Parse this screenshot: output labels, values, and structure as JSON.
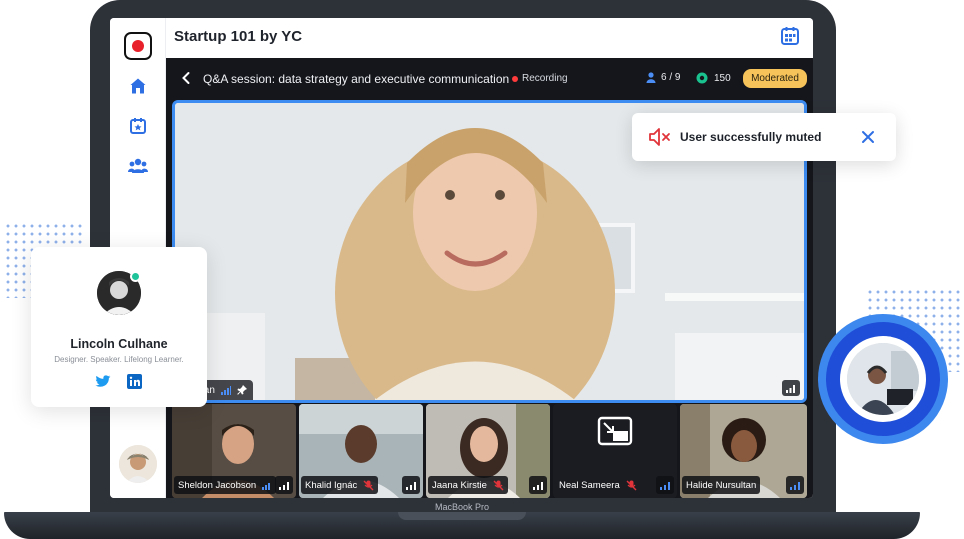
{
  "app": {
    "title": "Startup 101 by YC"
  },
  "sidebar": {
    "items": [
      {
        "name": "record",
        "icon": "record-icon"
      },
      {
        "name": "home",
        "icon": "home-icon"
      },
      {
        "name": "events",
        "icon": "calendar-star-icon"
      },
      {
        "name": "community",
        "icon": "users-icon"
      }
    ]
  },
  "session": {
    "title": "Q&A session: data strategy and executive communication",
    "recording_label": "Recording",
    "participants": "6 / 9",
    "viewers": "150",
    "badge": "Moderated",
    "active_speaker": "herman"
  },
  "tiles": [
    {
      "name": "Sheldon Jacobson",
      "muted": false
    },
    {
      "name": "Khalid Ignác",
      "muted": true
    },
    {
      "name": "Jaana Kirstie",
      "muted": true
    },
    {
      "name": "Neal Sameera",
      "muted": true
    },
    {
      "name": "Halide Nursultan",
      "muted": false
    }
  ],
  "toast": {
    "message": "User successfully muted"
  },
  "profile": {
    "name": "Lincoln Culhane",
    "bio": "Designer. Speaker. Lifelong Learner."
  },
  "device_label": "MacBook Pro",
  "colors": {
    "accent": "#3d8cf2",
    "recording": "#ff3b3b",
    "badge": "#f6c35b",
    "online": "#1fc49a",
    "muted": "#e0343a"
  }
}
